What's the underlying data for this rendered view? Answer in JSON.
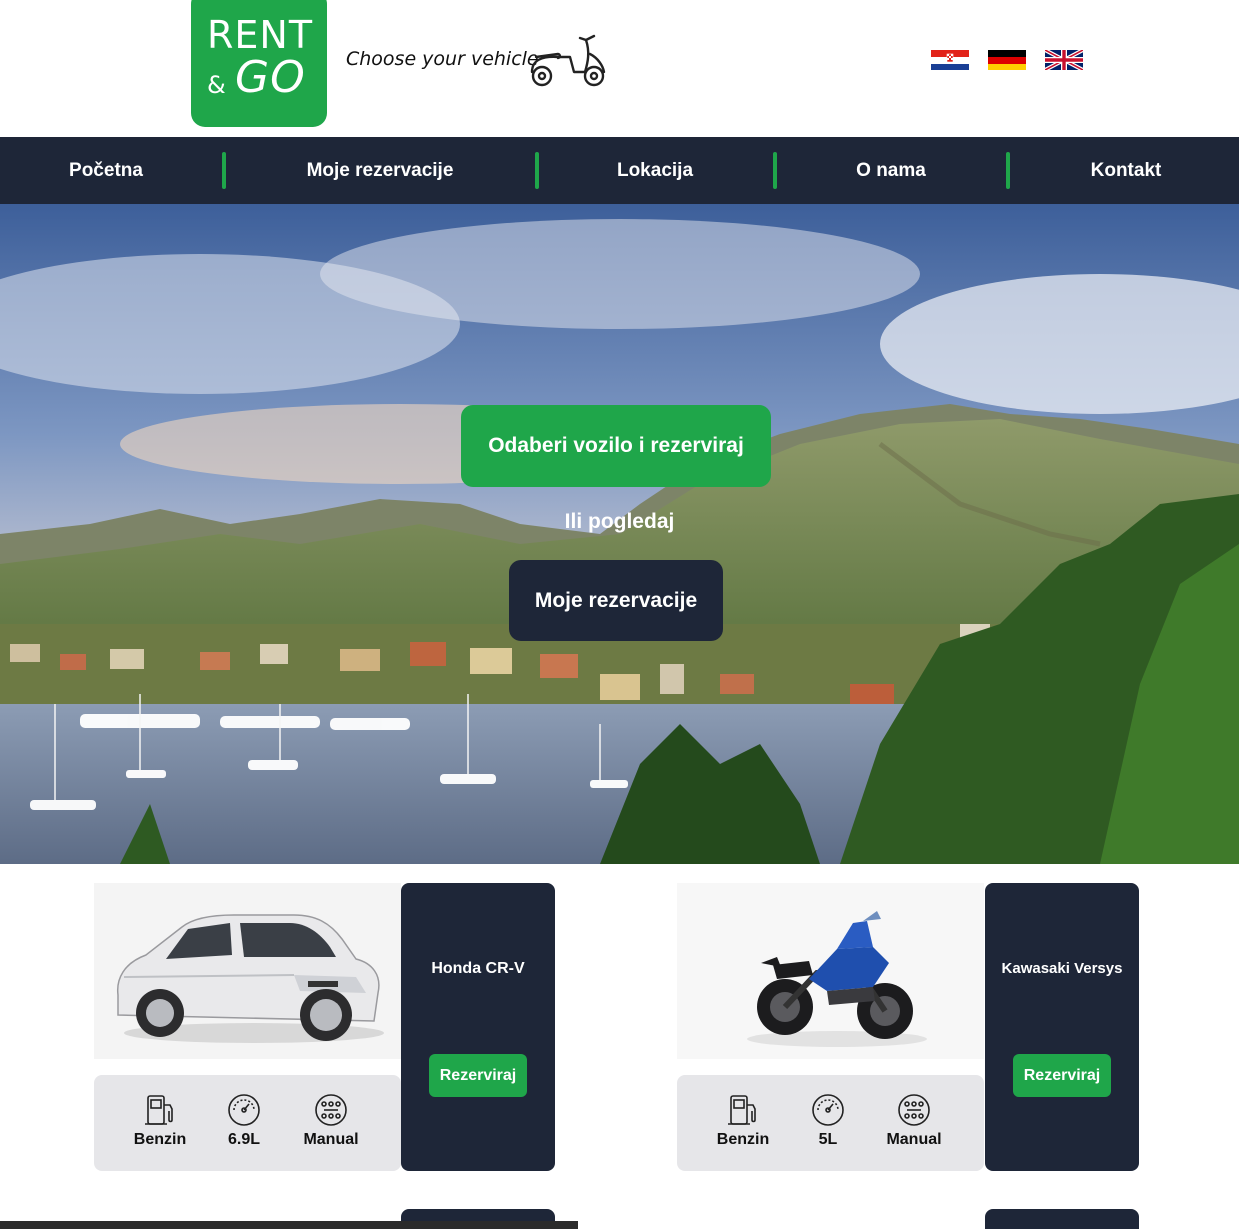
{
  "header": {
    "logo_top": "RENT",
    "logo_amp": "&",
    "logo_bottom": "GO",
    "tagline": "Choose your vehicle",
    "languages": [
      "hr",
      "de",
      "en"
    ]
  },
  "nav": {
    "items": [
      {
        "label": "Početna"
      },
      {
        "label": "Moje rezervacije"
      },
      {
        "label": "Lokacija"
      },
      {
        "label": "O nama"
      },
      {
        "label": "Kontakt"
      }
    ]
  },
  "hero": {
    "primary_button": "Odaberi vozilo i rezerviraj",
    "or_text": "Ili pogledaj",
    "secondary_button": "Moje rezervacije"
  },
  "vehicles": [
    {
      "name": "Honda CR-V",
      "book_label": "Rezerviraj",
      "fuel": "Benzin",
      "consumption": "6.9L",
      "transmission": "Manual",
      "image": "suv-car"
    },
    {
      "name": "Kawasaki Versys",
      "book_label": "Rezerviraj",
      "fuel": "Benzin",
      "consumption": "5L",
      "transmission": "Manual",
      "image": "motorcycle"
    }
  ],
  "colors": {
    "brand_green": "#1fa64a",
    "navy": "#1e2638"
  }
}
